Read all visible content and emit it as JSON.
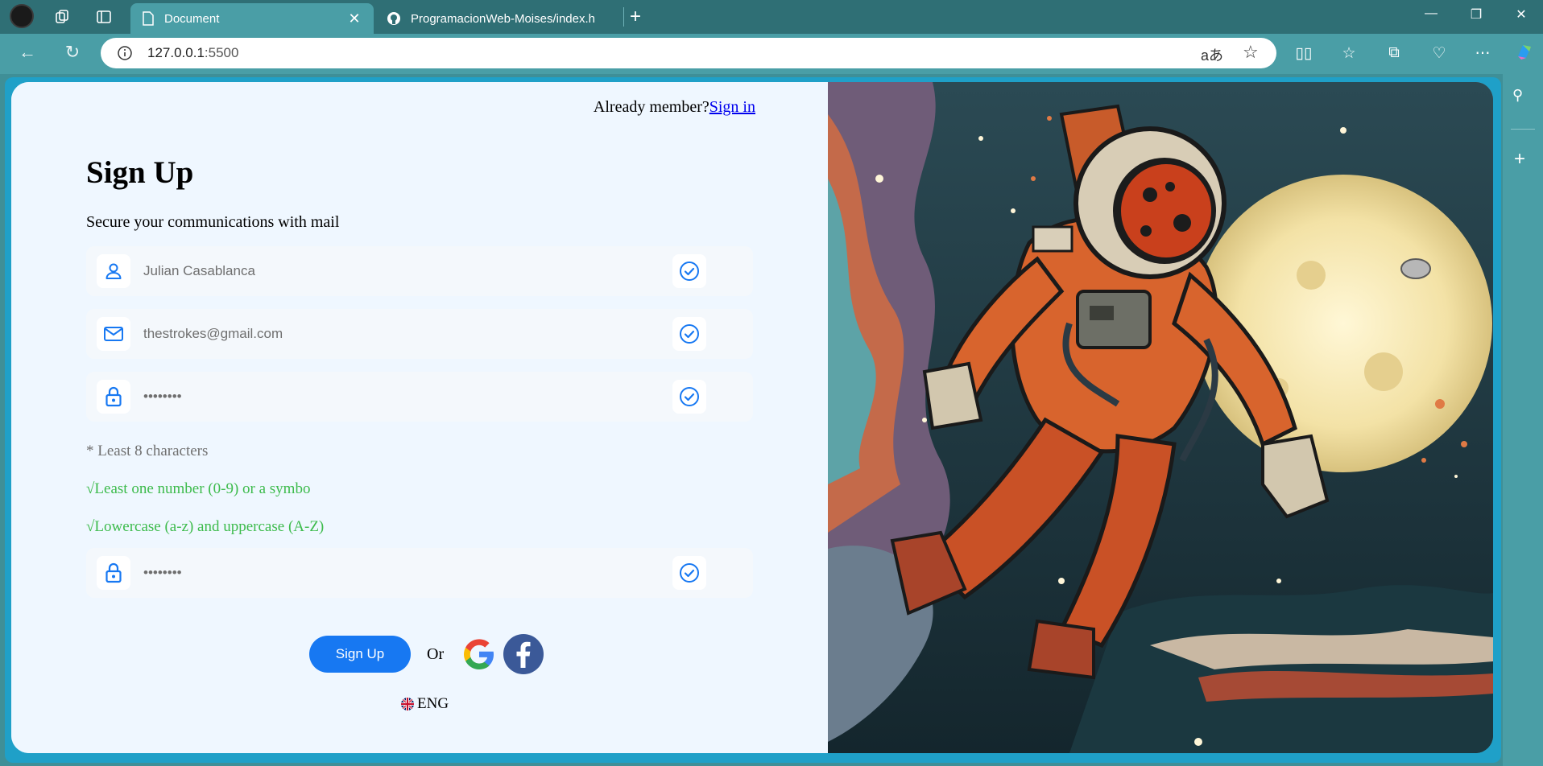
{
  "browser": {
    "tabs": [
      {
        "title": "Document",
        "active": true
      },
      {
        "title": "ProgramacionWeb-Moises/index.h",
        "active": false
      }
    ],
    "url_host": "127.0.0.1",
    "url_port": ":5500",
    "read_aloud_label": "aあ"
  },
  "page": {
    "already_member": "Already member?",
    "sign_in": "Sign in",
    "title": "Sign Up",
    "subtitle": "Secure your communications with mail",
    "fields": [
      {
        "icon": "user-icon",
        "value": "Julian Casablanca"
      },
      {
        "icon": "mail-icon",
        "value": "thestrokes@gmail.com"
      },
      {
        "icon": "lock-icon",
        "value": "••••••••"
      },
      {
        "icon": "lock-icon",
        "value": "••••••••"
      }
    ],
    "rules": [
      {
        "text": "* Least 8 characters",
        "status": "pending"
      },
      {
        "text": "√Least one number (0-9) or a symbo",
        "status": "ok"
      },
      {
        "text": "√Lowercase (a-z) and uppercase (A-Z)",
        "status": "ok"
      }
    ],
    "signup_button": "Sign Up",
    "or_label": "Or",
    "language": "ENG"
  },
  "colors": {
    "accent": "#1778f2",
    "valid_green": "#3dbb4c",
    "page_bg": "#eff7ff",
    "chrome_teal": "#4a9ea6"
  }
}
